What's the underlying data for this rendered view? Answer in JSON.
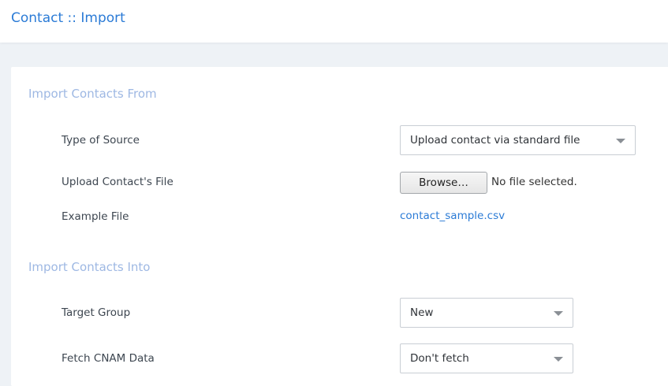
{
  "header": {
    "title": "Contact :: Import"
  },
  "import_from": {
    "section_title": "Import Contacts From",
    "type_of_source": {
      "label": "Type of Source",
      "value": "Upload contact via standard file"
    },
    "upload_file": {
      "label": "Upload Contact's File",
      "button_label": "Browse…",
      "status": "No file selected."
    },
    "example_file": {
      "label": "Example File",
      "link_text": "contact_sample.csv"
    }
  },
  "import_into": {
    "section_title": "Import Contacts Into",
    "target_group": {
      "label": "Target Group",
      "value": "New"
    },
    "fetch_cnam": {
      "label": "Fetch CNAM Data",
      "value": "Don't fetch"
    }
  },
  "icons": {
    "dropdown": "chevron-down-icon"
  },
  "colors": {
    "accent": "#2b7bd6",
    "section_title": "#9eb8e3",
    "background": "#eef2f6"
  }
}
